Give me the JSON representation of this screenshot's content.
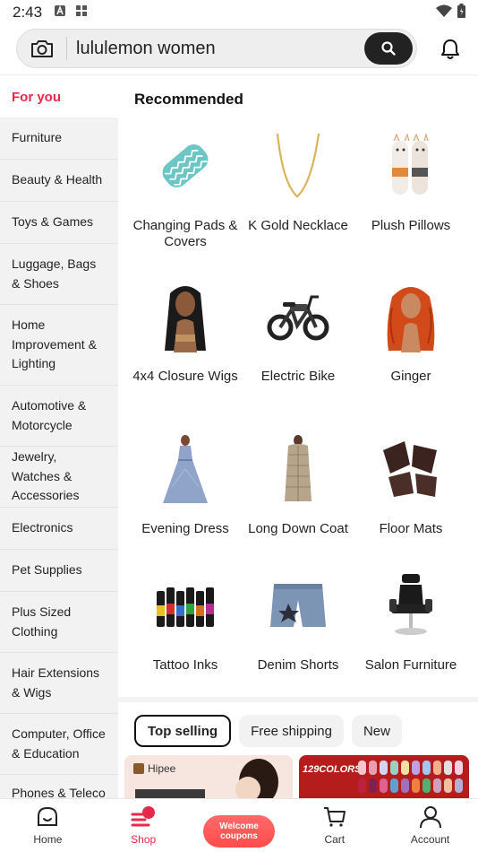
{
  "status_bar": {
    "time": "2:43"
  },
  "search": {
    "query": "lululemon women"
  },
  "sidebar": {
    "selected": "For you",
    "items": [
      {
        "label": "Furniture"
      },
      {
        "label": "Beauty & Health"
      },
      {
        "label": "Toys & Games"
      },
      {
        "label": "Luggage, Bags & Shoes"
      },
      {
        "label": "Home Improvement & Lighting"
      },
      {
        "label": "Automotive & Motorcycle"
      },
      {
        "label": "Jewelry, Watches & Accessories"
      },
      {
        "label": "Electronics"
      },
      {
        "label": "Pet Supplies"
      },
      {
        "label": "Plus Sized Clothing"
      },
      {
        "label": "Hair Extensions & Wigs"
      },
      {
        "label": "Computer, Office & Education"
      },
      {
        "label": "Phones & Teleco"
      }
    ]
  },
  "main": {
    "title": "Recommended",
    "categories": [
      {
        "label": "Changing Pads & Covers",
        "icon": "changing-pad-icon"
      },
      {
        "label": "K Gold Necklace",
        "icon": "necklace-icon"
      },
      {
        "label": "Plush Pillows",
        "icon": "plush-pillow-icon"
      },
      {
        "label": "4x4 Closure Wigs",
        "icon": "wig-icon"
      },
      {
        "label": "Electric Bike",
        "icon": "electric-bike-icon"
      },
      {
        "label": "Ginger",
        "icon": "ginger-wig-icon"
      },
      {
        "label": "Evening Dress",
        "icon": "evening-dress-icon"
      },
      {
        "label": "Long Down Coat",
        "icon": "coat-icon"
      },
      {
        "label": "Floor Mats",
        "icon": "floor-mats-icon"
      },
      {
        "label": "Tattoo Inks",
        "icon": "tattoo-inks-icon"
      },
      {
        "label": "Denim Shorts",
        "icon": "denim-shorts-icon"
      },
      {
        "label": "Salon Furniture",
        "icon": "salon-chair-icon"
      }
    ],
    "filters": [
      {
        "label": "Top selling",
        "active": true
      },
      {
        "label": "Free shipping",
        "active": false
      },
      {
        "label": "New",
        "active": false
      }
    ],
    "banners": {
      "brand": "Hipee",
      "colors": "129COLORS"
    }
  },
  "bottom_nav": {
    "home": "Home",
    "shop": "Shop",
    "welcome": "Welcome coupons",
    "cart": "Cart",
    "account": "Account"
  },
  "colors": {
    "accent": "#e8284a",
    "search_button": "#222222"
  }
}
